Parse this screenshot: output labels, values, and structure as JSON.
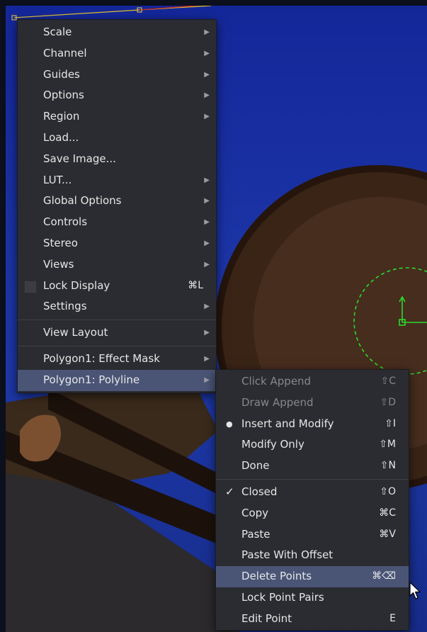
{
  "main_menu": {
    "items": [
      {
        "label": "Scale",
        "submenu": true
      },
      {
        "label": "Channel",
        "submenu": true
      },
      {
        "label": "Guides",
        "submenu": true
      },
      {
        "label": "Options",
        "submenu": true
      },
      {
        "label": "Region",
        "submenu": true
      },
      {
        "label": "Load...",
        "submenu": false
      },
      {
        "label": "Save Image...",
        "submenu": false
      },
      {
        "label": "LUT...",
        "submenu": true
      },
      {
        "label": "Global Options",
        "submenu": true
      },
      {
        "label": "Controls",
        "submenu": true
      },
      {
        "label": "Stereo",
        "submenu": true
      },
      {
        "label": "Views",
        "submenu": true
      },
      {
        "label": "Lock Display",
        "shortcut": "⌘L",
        "checkbox": true
      },
      {
        "label": "Settings",
        "submenu": true
      },
      {
        "label": "View Layout",
        "submenu": true
      },
      {
        "label": "Polygon1: Effect Mask",
        "submenu": true
      },
      {
        "label": "Polygon1: Polyline",
        "submenu": true,
        "selected": true
      }
    ]
  },
  "sub_menu": {
    "items": [
      {
        "label": "Click Append",
        "shortcut": "⇧C",
        "disabled": true
      },
      {
        "label": "Draw Append",
        "shortcut": "⇧D",
        "disabled": true
      },
      {
        "label": "Insert and Modify",
        "shortcut": "⇧I",
        "bullet": "●"
      },
      {
        "label": "Modify Only",
        "shortcut": "⇧M"
      },
      {
        "label": "Done",
        "shortcut": "⇧N"
      },
      {
        "label": "Closed",
        "shortcut": "⇧O",
        "check": "✓"
      },
      {
        "label": "Copy",
        "shortcut": "⌘C"
      },
      {
        "label": "Paste",
        "shortcut": "⌘V"
      },
      {
        "label": "Paste With Offset",
        "shortcut": ""
      },
      {
        "label": "Delete Points",
        "shortcut": "⌘⌫",
        "selected": true
      },
      {
        "label": "Lock Point Pairs",
        "shortcut": ""
      },
      {
        "label": "Edit Point",
        "shortcut": "E"
      }
    ]
  },
  "glyphs": {
    "submenu_arrow": "▶"
  },
  "colors": {
    "menu_bg": "#2a2c31",
    "highlight": "#4a5576",
    "sky": "#1b34a6",
    "guide_green": "#2bd92b"
  }
}
